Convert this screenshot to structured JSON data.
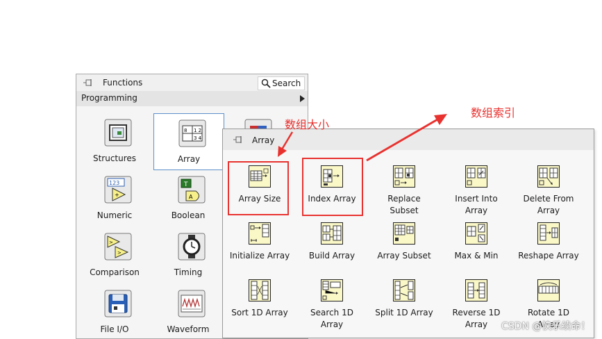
{
  "functions_palette": {
    "title": "Functions",
    "search_label": "Search",
    "category": "Programming",
    "items": [
      {
        "label": "Structures",
        "icon": "structures-icon"
      },
      {
        "label": "Array",
        "icon": "array-icon",
        "selected": true
      },
      {
        "label": "Numeric",
        "icon": "numeric-icon"
      },
      {
        "label": "Boolean",
        "icon": "boolean-icon"
      },
      {
        "label": "Comparison",
        "icon": "comparison-icon"
      },
      {
        "label": "Timing",
        "icon": "timing-icon"
      },
      {
        "label": "File I/O",
        "icon": "file-io-icon"
      },
      {
        "label": "Waveform",
        "icon": "waveform-icon"
      }
    ]
  },
  "array_palette": {
    "title": "Array",
    "items": [
      {
        "label": "Array Size",
        "icon": "array-size-icon"
      },
      {
        "label": "Index Array",
        "icon": "index-array-icon"
      },
      {
        "label": "Replace\nSubset",
        "icon": "replace-subset-icon"
      },
      {
        "label": "Insert Into\nArray",
        "icon": "insert-into-array-icon"
      },
      {
        "label": "Delete From\nArray",
        "icon": "delete-from-array-icon"
      },
      {
        "label": "Initialize Array",
        "icon": "initialize-array-icon"
      },
      {
        "label": "Build Array",
        "icon": "build-array-icon"
      },
      {
        "label": "Array Subset",
        "icon": "array-subset-icon"
      },
      {
        "label": "Max & Min",
        "icon": "max-min-icon"
      },
      {
        "label": "Reshape Array",
        "icon": "reshape-array-icon"
      },
      {
        "label": "Sort 1D Array",
        "icon": "sort-1d-array-icon"
      },
      {
        "label": "Search 1D\nArray",
        "icon": "search-1d-array-icon"
      },
      {
        "label": "Split 1D Array",
        "icon": "split-1d-array-icon"
      },
      {
        "label": "Reverse 1D\nArray",
        "icon": "reverse-1d-array-icon"
      },
      {
        "label": "Rotate 1D\nArray",
        "icon": "rotate-1d-array-icon"
      }
    ]
  },
  "annotations": {
    "array_size_note": "数组大小",
    "index_array_note": "数组索引",
    "color": "#e8322f"
  },
  "watermark": "CSDN @快乐续命！"
}
